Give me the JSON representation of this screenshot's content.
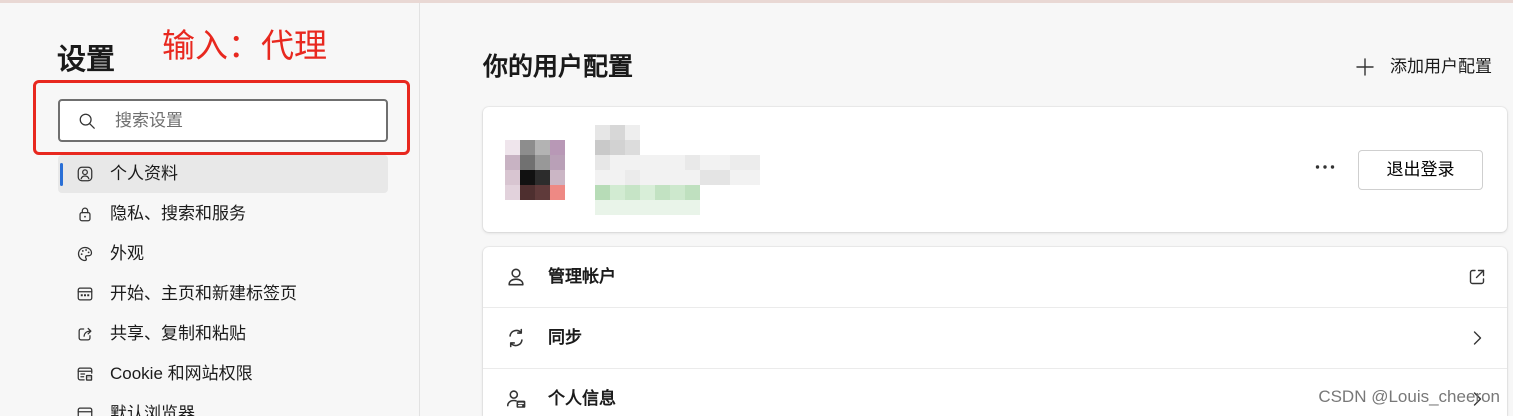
{
  "colors": {
    "accent": "#2a6fd6",
    "annotation": "#e8281f",
    "page_bg": "#f7f7f7"
  },
  "annotation": {
    "text": "输入：代理"
  },
  "sidebar": {
    "title": "设置",
    "search": {
      "placeholder": "搜索设置",
      "value": "",
      "icon": "search-icon"
    },
    "items": [
      {
        "label": "个人资料",
        "icon": "profile-icon",
        "selected": true
      },
      {
        "label": "隐私、搜索和服务",
        "icon": "lock-icon",
        "selected": false
      },
      {
        "label": "外观",
        "icon": "palette-icon",
        "selected": false
      },
      {
        "label": "开始、主页和新建标签页",
        "icon": "new-tab-page-icon",
        "selected": false
      },
      {
        "label": "共享、复制和粘贴",
        "icon": "share-icon",
        "selected": false
      },
      {
        "label": "Cookie 和网站权限",
        "icon": "site-permissions-icon",
        "selected": false
      },
      {
        "label": "默认浏览器",
        "icon": "default-browser-icon",
        "selected": false
      }
    ]
  },
  "main": {
    "title": "你的用户配置",
    "add_profile": {
      "label": "添加用户配置",
      "icon": "plus-icon"
    },
    "profile_card": {
      "more_icon": "more-horizontal-icon",
      "sign_out_label": "退出登录"
    },
    "rows": [
      {
        "label": "管理帐户",
        "icon": "person-icon",
        "trailing_icon": "external-link-icon"
      },
      {
        "label": "同步",
        "icon": "sync-icon",
        "trailing_icon": "chevron-right-icon"
      },
      {
        "label": "个人信息",
        "icon": "contact-card-icon",
        "trailing_icon": "chevron-right-icon"
      }
    ]
  },
  "watermark": "CSDN @Louis_cheeron"
}
